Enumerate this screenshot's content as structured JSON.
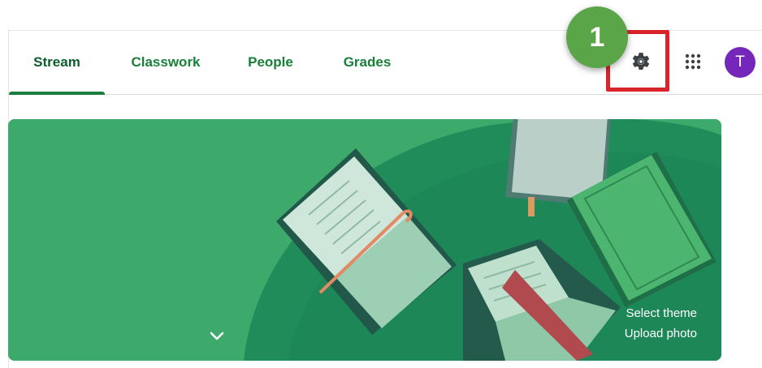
{
  "tabs": [
    {
      "label": "Stream",
      "active": true
    },
    {
      "label": "Classwork",
      "active": false
    },
    {
      "label": "People",
      "active": false
    },
    {
      "label": "Grades",
      "active": false
    }
  ],
  "toolbar": {
    "settings_icon": "gear-icon",
    "apps_icon": "apps-grid-icon"
  },
  "avatar": {
    "initial": "T",
    "color": "#7627bb"
  },
  "annotation": {
    "step_number": "1",
    "badge_color": "#5aa547",
    "box_color": "#d7252b"
  },
  "banner": {
    "select_theme_label": "Select theme",
    "upload_photo_label": "Upload photo",
    "expand_icon": "chevron-down-icon",
    "background_color": "#3daa6c"
  },
  "colors": {
    "accent": "#188038"
  }
}
